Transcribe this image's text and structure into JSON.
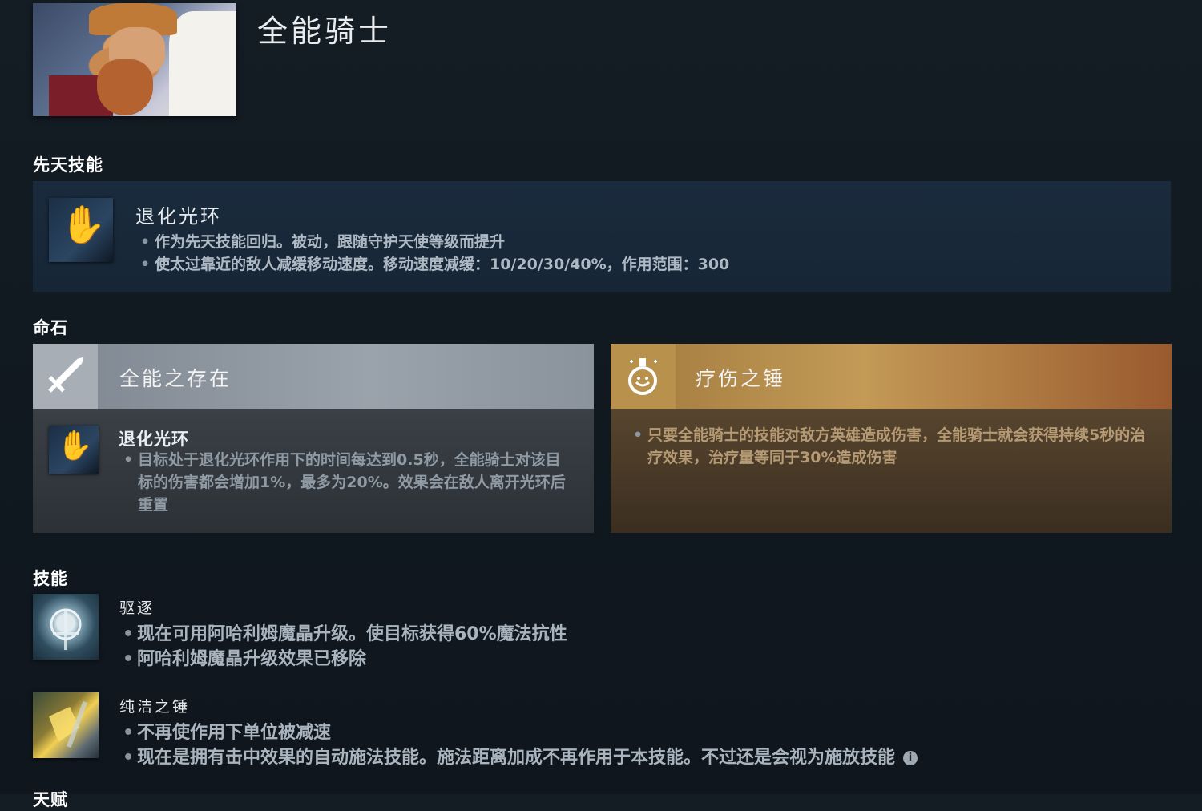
{
  "hero": {
    "name": "全能骑士"
  },
  "innate": {
    "section_title": "先天技能",
    "name": "退化光环",
    "lines": [
      "作为先天技能回归。被动，跟随守护天使等级而提升",
      "使太过靠近的敌人减缓移动速度。移动速度减缓：10/20/30/40%，作用范围：300"
    ],
    "icon": "glove-icon"
  },
  "facets": {
    "section_title": "命石",
    "left": {
      "title": "全能之存在",
      "icon": "sword-icon",
      "sub_name": "退化光环",
      "lines": [
        "目标处于退化光环作用下的时间每达到0.5秒，全能骑士对该目标的伤害都会增加1%，最多为20%。效果会在敌人离开光环后重置"
      ],
      "colors": {
        "head": "#8f98a1",
        "body": "#33393e"
      }
    },
    "right": {
      "title": "疗伤之锤",
      "icon": "heal-flask-icon",
      "lines": [
        "只要全能骑士的技能对敌方英雄造成伤害，全能骑士就会获得持续5秒的治疗效果，治疗量等同于30%造成伤害"
      ],
      "colors": {
        "head": "#b68b4a",
        "body": "#4a3926"
      }
    }
  },
  "abilities": {
    "section_title": "技能",
    "items": [
      {
        "name": "驱逐",
        "icon": "repel-icon",
        "lines": [
          "现在可用阿哈利姆魔晶升级。使目标获得60%魔法抗性",
          "阿哈利姆魔晶升级效果已移除"
        ]
      },
      {
        "name": "纯洁之锤",
        "icon": "hammer-icon",
        "lines": [
          "不再使作用下单位被减速",
          "现在是拥有击中效果的自动施法技能。施法距离加成不再作用于本技能。不过还是会视为施放技能"
        ]
      }
    ]
  },
  "next_section_title": "天赋"
}
